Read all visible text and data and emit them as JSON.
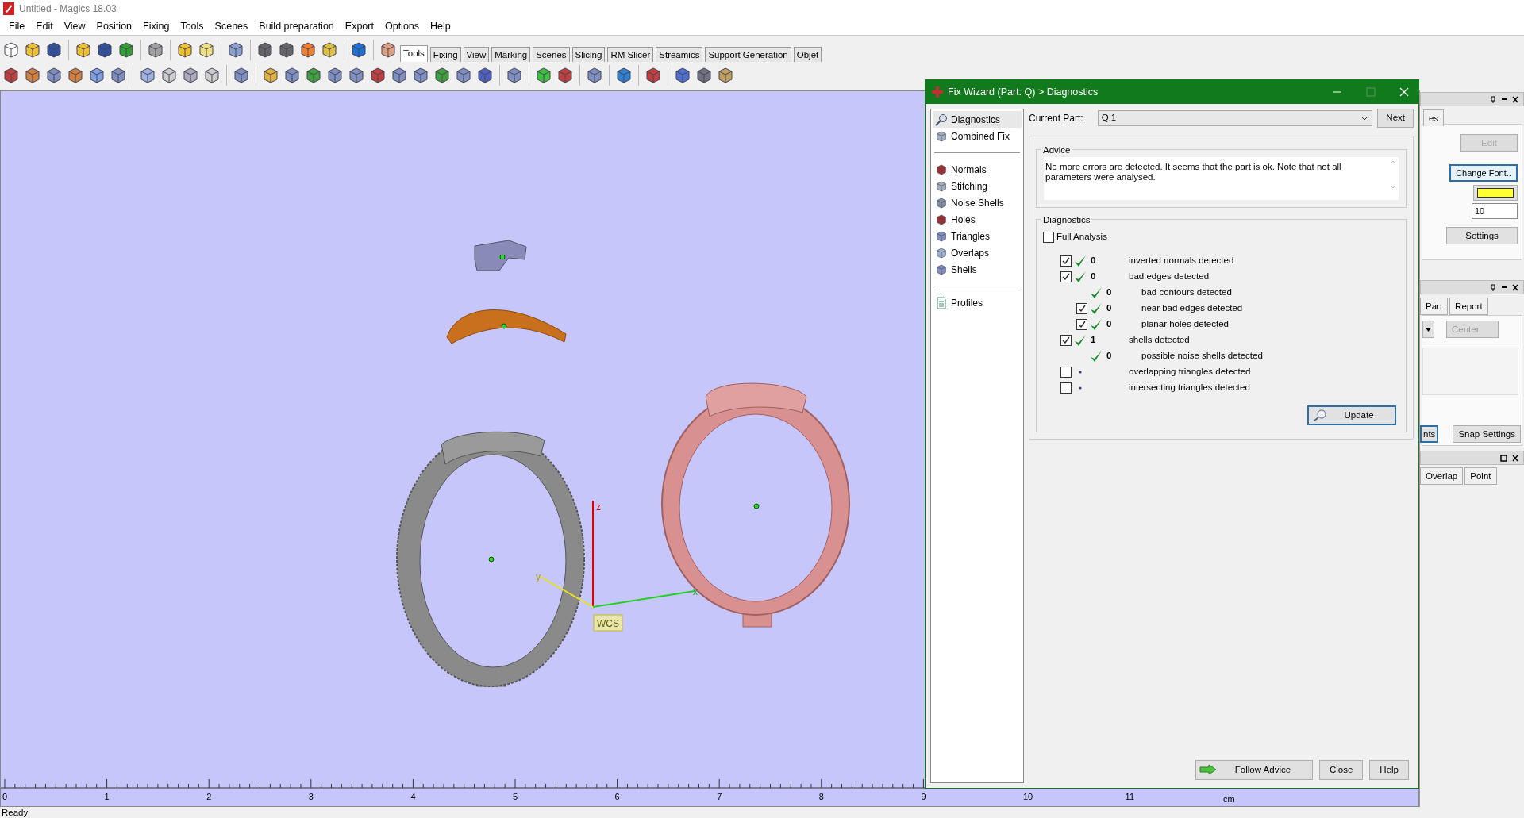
{
  "window": {
    "title": "Untitled - Magics 18.03"
  },
  "menu": [
    "File",
    "Edit",
    "View",
    "Position",
    "Fixing",
    "Tools",
    "Scenes",
    "Build preparation",
    "Export",
    "Options",
    "Help"
  ],
  "toolbar_tabs": [
    {
      "label": "Tools",
      "selected": true
    },
    {
      "label": "Fixing",
      "selected": false
    },
    {
      "label": "View",
      "selected": false
    },
    {
      "label": "Marking",
      "selected": false
    },
    {
      "label": "Scenes",
      "selected": false
    },
    {
      "label": "Slicing",
      "selected": false
    },
    {
      "label": "RM Slicer",
      "selected": false
    },
    {
      "label": "Streamics",
      "selected": false
    },
    {
      "label": "Support Generation",
      "selected": false
    },
    {
      "label": "Objet",
      "selected": false
    }
  ],
  "viewport": {
    "axes": {
      "z": "z",
      "x": "x",
      "y": "y",
      "origin": "WCS"
    },
    "ruler": {
      "ticks": [
        "0",
        "1",
        "2",
        "3",
        "4",
        "5",
        "6",
        "7",
        "8",
        "9",
        "10",
        "11"
      ],
      "unit": "cm"
    }
  },
  "dialog": {
    "title": "Fix Wizard (Part: Q) > Diagnostics",
    "nav": [
      [
        {
          "label": "Diagnostics",
          "selected": true
        },
        {
          "label": "Combined Fix",
          "selected": false
        }
      ],
      [
        {
          "label": "Normals",
          "selected": false
        },
        {
          "label": "Stitching",
          "selected": false
        },
        {
          "label": "Noise Shells",
          "selected": false
        },
        {
          "label": "Holes",
          "selected": false
        },
        {
          "label": "Triangles",
          "selected": false
        },
        {
          "label": "Overlaps",
          "selected": false
        },
        {
          "label": "Shells",
          "selected": false
        }
      ],
      [
        {
          "label": "Profiles",
          "selected": false
        }
      ]
    ],
    "current_part_label": "Current Part:",
    "current_part": "Q.1",
    "next_button": "Next",
    "advice": {
      "title": "Advice",
      "text": "No more errors are detected. It seems that the part is ok. Note that not all parameters were analysed."
    },
    "diagnostics": {
      "title": "Diagnostics",
      "full_analysis": {
        "label": "Full Analysis",
        "checked": false
      },
      "rows": [
        {
          "kind": "checkbox",
          "checked": true,
          "passed": true,
          "count": "0",
          "label": "inverted normals detected"
        },
        {
          "kind": "checkbox",
          "checked": true,
          "passed": true,
          "count": "0",
          "label": "bad edges detected",
          "children": [
            {
              "kind": "plain",
              "passed": true,
              "count": "0",
              "label": "bad contours detected"
            },
            {
              "kind": "checkbox",
              "checked": true,
              "passed": true,
              "count": "0",
              "label": "near bad edges detected"
            },
            {
              "kind": "checkbox",
              "checked": true,
              "passed": true,
              "count": "0",
              "label": "planar holes detected"
            }
          ]
        },
        {
          "kind": "checkbox",
          "checked": true,
          "passed": true,
          "count": "1",
          "label": "shells detected",
          "children": [
            {
              "kind": "plain",
              "passed": true,
              "count": "0",
              "label": "possible noise shells detected"
            }
          ]
        },
        {
          "kind": "checkbox",
          "checked": false,
          "passed": false,
          "label": "overlapping triangles detected"
        },
        {
          "kind": "checkbox",
          "checked": false,
          "passed": false,
          "label": "intersecting triangles detected"
        }
      ],
      "update_button": "Update"
    },
    "buttons": [
      "Follow Advice",
      "Close",
      "Help"
    ]
  },
  "right_panels": {
    "tab_stub": "es",
    "edit_button": "Edit",
    "font_button": "Change Font..",
    "color": "#ffff33",
    "size": "10",
    "settings_button": "Settings",
    "tabs": [
      "Part",
      "Report"
    ],
    "align": "Center",
    "stub_button": "nts",
    "snap_button": "Snap Settings",
    "tabs2": [
      "Overlap",
      "Point"
    ]
  },
  "status_bar": "Ready"
}
